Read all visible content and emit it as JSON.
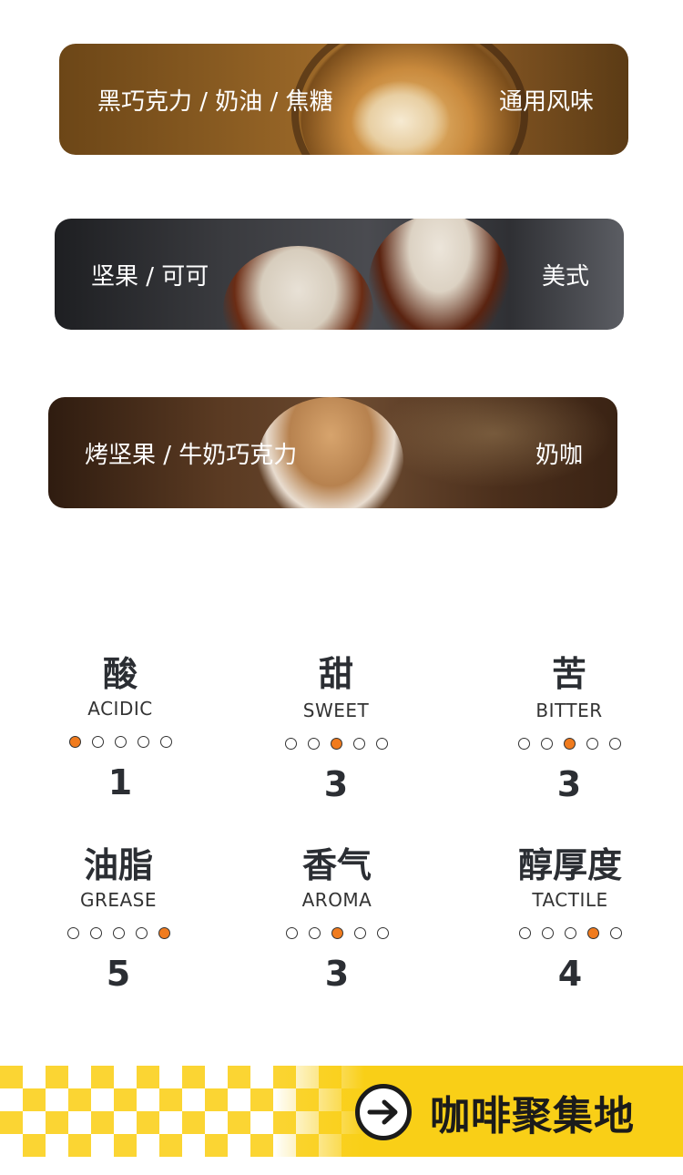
{
  "flavors": [
    {
      "title": "黑巧克力 / 奶油 / 焦糖",
      "type": "通用风味"
    },
    {
      "title": "坚果 / 可可",
      "type": "美式"
    },
    {
      "title": "烤坚果 / 牛奶巧克力",
      "type": "奶咖"
    }
  ],
  "metrics": [
    {
      "zh": "酸",
      "en": "ACIDIC",
      "level": 1,
      "value": "1"
    },
    {
      "zh": "甜",
      "en": "SWEET",
      "level": 3,
      "value": "3"
    },
    {
      "zh": "苦",
      "en": "BITTER",
      "level": 3,
      "value": "3"
    },
    {
      "zh": "油脂",
      "en": "GREASE",
      "level": 5,
      "value": "5"
    },
    {
      "zh": "香气",
      "en": "AROMA",
      "level": 3,
      "value": "3"
    },
    {
      "zh": "醇厚度",
      "en": "TACTILE",
      "level": 4,
      "value": "4"
    }
  ],
  "scale_max": 5,
  "footer": {
    "label": "咖啡聚集地",
    "icon": "arrow-right-icon"
  },
  "colors": {
    "accent": "#f07b1e",
    "banner": "#f9cf17",
    "text": "#2b2e33"
  }
}
